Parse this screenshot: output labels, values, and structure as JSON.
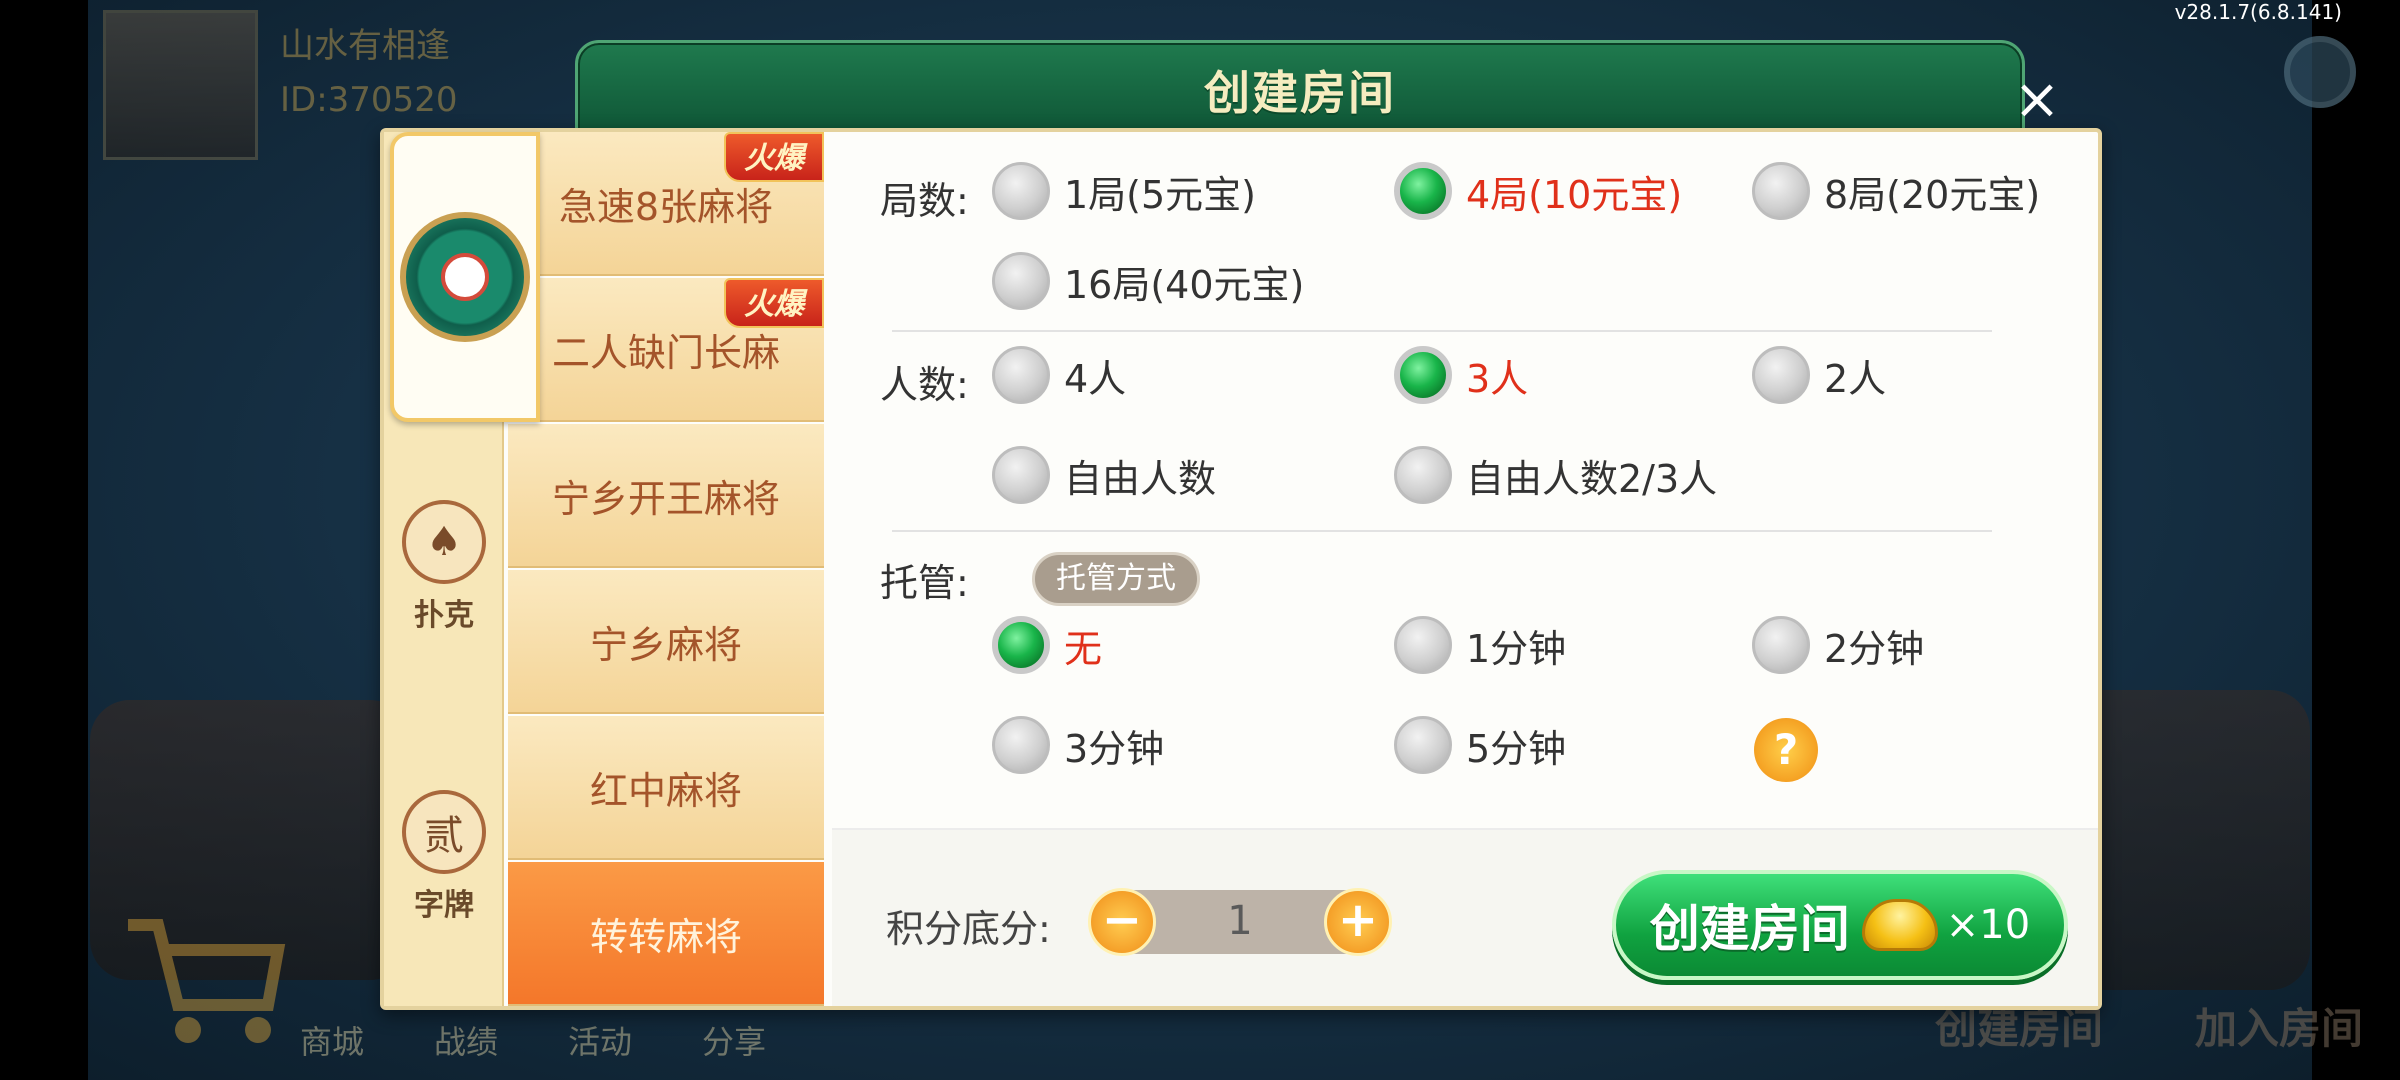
{
  "meta": {
    "version": "v28.1.7(6.8.141)"
  },
  "player": {
    "name": "山水有相逢",
    "id": "ID:370520"
  },
  "background": {
    "bottom_tabs": [
      "商城",
      "战绩",
      "活动",
      "分享"
    ],
    "create_room": "创建房间",
    "join_room": "加入房间"
  },
  "dialog": {
    "title": "创建房间",
    "close": "×",
    "categories": [
      {
        "label": "",
        "icon": "mahjong-emblem-icon"
      },
      {
        "label": "扑克",
        "icon": "spade-icon",
        "glyph": "♠"
      },
      {
        "label": "字牌",
        "icon": "er-icon",
        "glyph": "贰"
      }
    ],
    "games": [
      {
        "label": "急速8张麻将",
        "badge": "火爆"
      },
      {
        "label": "二人缺门长麻",
        "badge": "火爆"
      },
      {
        "label": "宁乡开王麻将",
        "badge": ""
      },
      {
        "label": "宁乡麻将",
        "badge": ""
      },
      {
        "label": "红中麻将",
        "badge": ""
      },
      {
        "label": "转转麻将",
        "badge": "",
        "selected": true
      }
    ],
    "rounds": {
      "label": "局数:",
      "options": [
        "1局(5元宝)",
        "4局(10元宝)",
        "8局(20元宝)",
        "16局(40元宝)"
      ],
      "selected": "4局(10元宝)"
    },
    "players": {
      "label": "人数:",
      "options": [
        "4人",
        "3人",
        "2人",
        "自由人数",
        "自由人数2/3人"
      ],
      "selected": "3人"
    },
    "trustee": {
      "label": "托管:",
      "mode_button": "托管方式",
      "options": [
        "无",
        "1分钟",
        "2分钟",
        "3分钟",
        "5分钟"
      ],
      "selected": "无",
      "help": "?"
    },
    "score": {
      "label": "积分底分:",
      "value": "1",
      "minus": "−",
      "plus": "+"
    },
    "create_button": {
      "label": "创建房间",
      "cost": "×10"
    }
  }
}
